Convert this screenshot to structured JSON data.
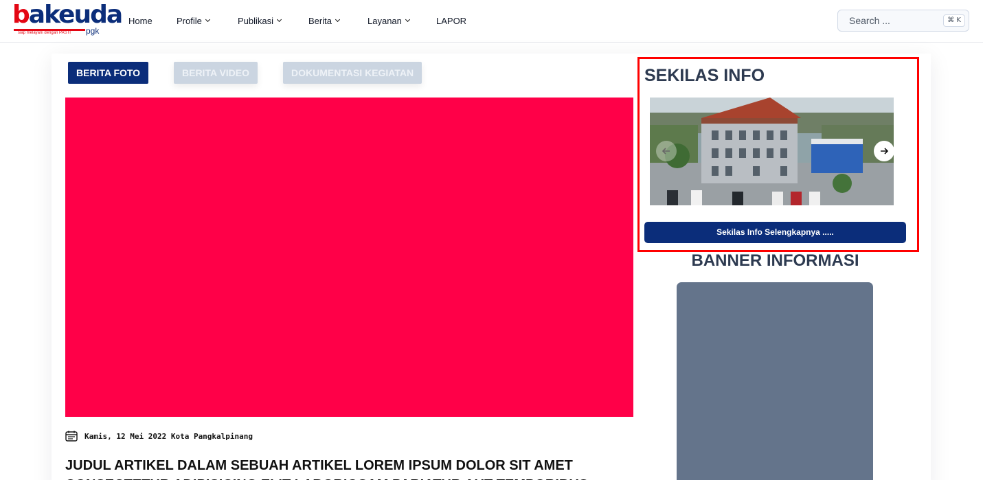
{
  "brand": {
    "logo_text_b": "b",
    "logo_text_rest": "akeuda",
    "logo_tagline": "siap melayani dengan PASTI",
    "logo_pgk": "pgk",
    "colors": {
      "red": "#e30613",
      "navy": "#0b2d7a"
    }
  },
  "nav": {
    "items": [
      {
        "label": "Home",
        "has_dropdown": false
      },
      {
        "label": "Profile",
        "has_dropdown": true
      },
      {
        "label": "Publikasi",
        "has_dropdown": true
      },
      {
        "label": "Berita",
        "has_dropdown": true
      },
      {
        "label": "Layanan",
        "has_dropdown": true
      },
      {
        "label": "LAPOR",
        "has_dropdown": false
      }
    ]
  },
  "search": {
    "placeholder": "Search ...",
    "shortcut": "⌘ K"
  },
  "tabs": [
    {
      "label": "BERITA FOTO",
      "active": true
    },
    {
      "label": "BERITA VIDEO",
      "active": false
    },
    {
      "label": "DOKUMENTASI KEGIATAN",
      "active": false
    }
  ],
  "article": {
    "media_color": "#ff0048",
    "date_location": "Kamis, 12 Mei 2022 Kota Pangkalpinang",
    "title": "JUDUL ARTIKEL DALAM SEBUAH ARTIKEL LOREM IPSUM DOLOR SIT AMET CONSECTETUR ADIPISICING ELIT LABORIOSAM PARIATUR AUT TEMPORIBUS"
  },
  "sidebar": {
    "sekilas_title": "SEKILAS INFO",
    "carousel_image": "aerial-office-building-photo",
    "prev_icon": "arrow-left-icon",
    "next_icon": "arrow-right-icon",
    "more_label": "Sekilas Info Selengkapnya .....",
    "banner_title": "BANNER INFORMASI",
    "highlight_color": "#ff0000"
  }
}
